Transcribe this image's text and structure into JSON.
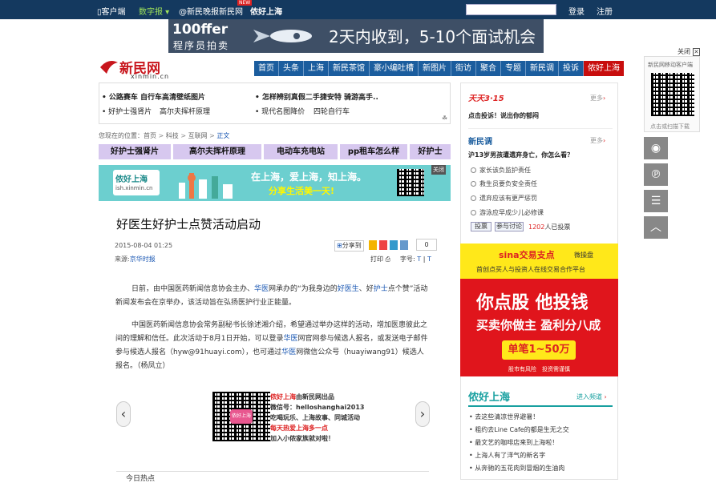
{
  "topbar": {
    "client": "客户端",
    "digital": "数字报",
    "weibo": "@新民晚报新民网",
    "hello": "侬好上海",
    "new_badge": "NEW",
    "search_placeholder": "",
    "login": "登录",
    "register": "注册"
  },
  "banner": {
    "brand_main": "100ffer",
    "brand_sub": "程序员拍卖",
    "slogan": "2天内收到，5-10个面试机会"
  },
  "logo": {
    "cn": "新民网",
    "en": "xinmin.cn"
  },
  "nav": [
    "首页",
    "头条",
    "上海",
    "新民茶馆",
    "豪小编吐槽",
    "新图片",
    "街访",
    "聚合",
    "专题",
    "新民调",
    "投诉",
    "侬好上海"
  ],
  "toplinks": {
    "l1": "公路赛车 自行车高清壁纸图片",
    "l2": "怎样辨别真假二手捷安特 骑游高手..",
    "l3": "好护士强肾片",
    "l4": "高尔夫挥杆原理",
    "l5": "现代名图降价",
    "l6": "四轮自行车"
  },
  "breadcrumb": {
    "prefix": "您现在的位置：",
    "items": [
      "首页",
      "科技",
      "互联网",
      "正文"
    ],
    "sep": ">"
  },
  "tabs": [
    "好护士强肾片",
    "高尔夫挥杆原理",
    "电动车充电站",
    "pp租车怎么样",
    "好护士"
  ],
  "adstrip": {
    "brand": "侬好上海",
    "url": "ish.xinmin.cn",
    "line1": "在上海，爱上海，知上海。",
    "line2": "分享生活美一天!",
    "close": "关闭"
  },
  "article": {
    "title": "好医生好护士点赞活动启动",
    "date": "2015-08-04 01:25",
    "source_label": "来源:",
    "source": "京华时报",
    "share": "分享到",
    "count": "0",
    "print": "打印",
    "fontsize": "字号:",
    "font_t1": "T",
    "font_sep": "|",
    "font_t2": "T",
    "p1a": "日前，由中国医药新闻信息协会主办、",
    "p1b": "华医",
    "p1c": "网承办的“为我身边的",
    "p1d": "好医生",
    "p1e": "、好",
    "p1f": "护士",
    "p1g": "点个赞”活动新闻发布会在京举办，该活动旨在弘扬医护行业正能量。",
    "p2a": "中国医药新闻信息协会常务副秘书长徐述湘介绍，希望通过举办这样的活动，增加医患彼此之间的理解和信任。此次活动于8月1日开始，可以登录",
    "p2b": "华医",
    "p2c": "网官网参与候选人报名，或发送电子邮件参与候选人报名（hyw@91huayi.com），也可通过",
    "p2d": "华医",
    "p2e": "网微信公众号（huayiwang91）候选人报名。（杨凤立）"
  },
  "promo": {
    "l1a": "侬好上海",
    "l1b": "由新民网出品",
    "l2": "微信号：helloshanghai2013",
    "l3": "吃喝玩乐、上海故事、同城活动",
    "l4": "每天热爱上海多一点",
    "l5": "加入小侬家族就对啦！",
    "qr_label": "侬好上海"
  },
  "bottom": {
    "hot": "今日热点"
  },
  "right": {
    "t315": "天天3·15",
    "more": "更多",
    "complain": "点击投诉！说出你的郁闷",
    "survey_title": "新民调",
    "question": "沪13岁男孩遭遗弃身亡，你怎么看？",
    "options": [
      "家长该负监护责任",
      "救生员要负安全责任",
      "遗弃应该有更严惩罚",
      "游泳应早成少儿必修课"
    ],
    "vote": "投票",
    "discuss": "参与讨论",
    "votes_count": "1202",
    "votes_label": "人已投票",
    "sina_brand": "sina交易支点",
    "sina_sub": "微操盘",
    "sina_desc": "首创点买人与投资人在线交易合作平台",
    "ad_line1": "你点股 他投钱",
    "ad_line2": "买卖你做主 盈利分八成",
    "ad_btn": "单笔1~50万",
    "ad_foot1": "股市有风险",
    "ad_foot2": "投资需谨慎",
    "hello_title": "侬好上海",
    "hello_more": "进入频道",
    "news": [
      "去这些清凉世界避暑！",
      "粗约去Line Cafe的都是生无之交",
      "最文艺的咖啡店来到上海啦！",
      "上海人有了洋气的新名字",
      "从奔驰的五花肉到冒烟的生油肉"
    ]
  },
  "float": {
    "close": "关闭",
    "client_title": "新民网移动客户端",
    "scan": "点击或扫描下载"
  }
}
